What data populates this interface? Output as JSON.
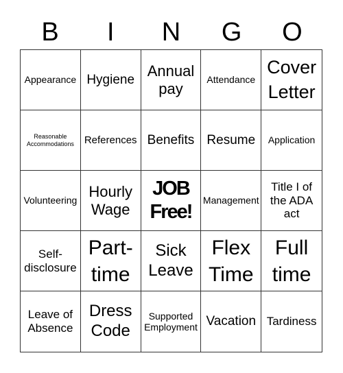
{
  "header": {
    "letters": [
      "B",
      "I",
      "N",
      "G",
      "O"
    ]
  },
  "cells": [
    {
      "text": "Appearance",
      "size": "s14"
    },
    {
      "text": "Hygiene",
      "size": "s19"
    },
    {
      "text": "Annual pay",
      "size": "s22"
    },
    {
      "text": "Attendance",
      "size": "s14"
    },
    {
      "text": "Cover Letter",
      "size": "s26"
    },
    {
      "text": "Reasonable Accommodations",
      "size": "s9"
    },
    {
      "text": "References",
      "size": "s15"
    },
    {
      "text": "Benefits",
      "size": "s19"
    },
    {
      "text": "Resume",
      "size": "s19"
    },
    {
      "text": "Application",
      "size": "s14"
    },
    {
      "text": "Volunteering",
      "size": "s14"
    },
    {
      "text": "Hourly Wage",
      "size": "s22"
    },
    {
      "text": "JOB Free!",
      "size": "free"
    },
    {
      "text": "Management",
      "size": "s14"
    },
    {
      "text": "Title I of the ADA act",
      "size": "s16"
    },
    {
      "text": "Self-disclosure",
      "size": "s16"
    },
    {
      "text": "Part-time",
      "size": "s30"
    },
    {
      "text": "Sick Leave",
      "size": "s24"
    },
    {
      "text": "Flex Time",
      "size": "s30"
    },
    {
      "text": "Full time",
      "size": "s30"
    },
    {
      "text": "Leave of Absence",
      "size": "s16"
    },
    {
      "text": "Dress Code",
      "size": "s24"
    },
    {
      "text": "Supported Employment",
      "size": "s14"
    },
    {
      "text": "Vacation",
      "size": "s19"
    },
    {
      "text": "Tardiness",
      "size": "s16"
    }
  ]
}
